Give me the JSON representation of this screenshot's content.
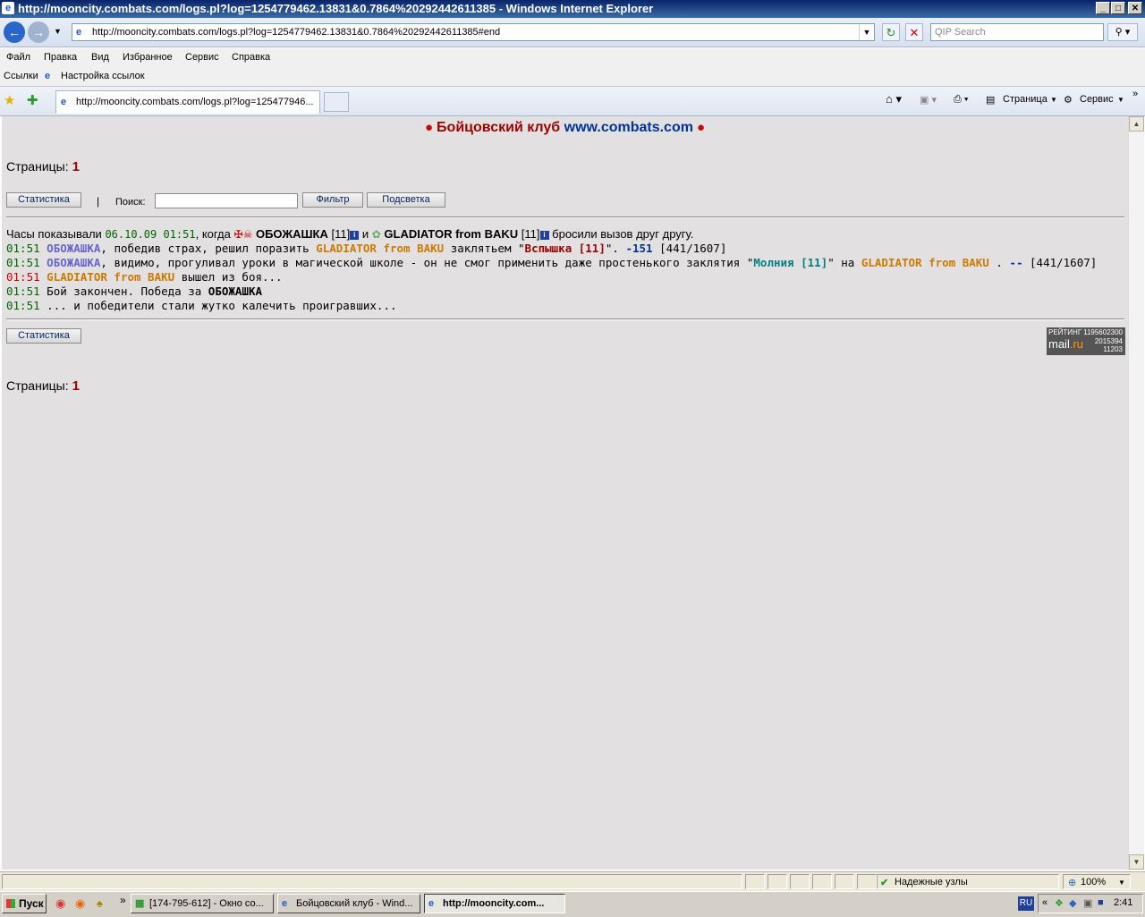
{
  "window": {
    "title": "http://mooncity.combats.com/logs.pl?log=1254779462.13831&0.7864%20292442611385 - Windows Internet Explorer",
    "btn_min": "_",
    "btn_max": "□",
    "btn_close": "✕"
  },
  "address": {
    "url": "http://mooncity.combats.com/logs.pl?log=1254779462.13831&0.7864%20292442611385#end",
    "search_placeholder": "QIP Search"
  },
  "menu": [
    "Файл",
    "Правка",
    "Вид",
    "Избранное",
    "Сервис",
    "Справка"
  ],
  "links_bar": {
    "label": "Ссылки",
    "item": "Настройка ссылок"
  },
  "tab": {
    "title": "http://mooncity.combats.com/logs.pl?log=125477946..."
  },
  "toolbar": {
    "page_label": "Страница",
    "tools_label": "Сервис"
  },
  "page": {
    "header_red": "Бойцовский клуб",
    "header_blue": "www.combats.com",
    "pages_label": "Страницы:",
    "pages_value": "1",
    "stats_btn": "Статистика",
    "separator": "|",
    "search_label": "Поиск:",
    "filter_btn": "Фильтр",
    "highlight_btn": "Подсветка"
  },
  "log": {
    "intro_prefix": "Часы показывали",
    "intro_date": "06.10.09 01:51",
    "intro_when": ", когда",
    "player1": "ОБОЖАШКА",
    "player1_level": "[11]",
    "and": "и",
    "player2": "GLADIATOR from BAKU",
    "player2_level": "[11]",
    "intro_suffix": "бросили вызов друг другу.",
    "line1_time": "01:51",
    "line1_a": ", победив страх, решил поразить",
    "line1_b": "заклятьем \"",
    "line1_spell": "Вспышка [11]",
    "line1_c": "\".",
    "line1_dmg": "-151",
    "line1_hp": "[441/1607]",
    "line2_time": "01:51",
    "line2_a": ", видимо, прогуливал уроки в магической школе - он не смог применить даже простенького заклятия \"",
    "line2_spell": "Молния [11]",
    "line2_b": "\" на",
    "line2_c": ".",
    "line2_dmg": "--",
    "line2_hp": "[441/1607]",
    "line3_time": "01:51",
    "line3_a": "вышел из боя...",
    "line4_time": "01:51",
    "line4_a": "Бой закончен. Победа за",
    "line5_time": "01:51",
    "line5_a": "... и победители стали жутко калечить проигравших..."
  },
  "counter": {
    "label": "РЕЙТИНГ",
    "brand_a": "mail",
    "brand_b": ".ru",
    "n1": "1195602300",
    "n2": "2015394",
    "n3": "11203"
  },
  "statusbar": {
    "zone": "Надежные узлы",
    "zoom": "100%"
  },
  "taskbar": {
    "start": "Пуск",
    "task1": "[174-795-612] - Окно со...",
    "task2": "Бойцовский клуб - Wind...",
    "task3": "http://mooncity.com...",
    "lang": "RU",
    "clock": "2:41"
  },
  "colors": {
    "header_red": "#990000",
    "header_blue": "#003399",
    "player1": "#6666cc",
    "player2": "#cc7a00",
    "time_green": "#006600",
    "time_red": "#cc0000"
  }
}
